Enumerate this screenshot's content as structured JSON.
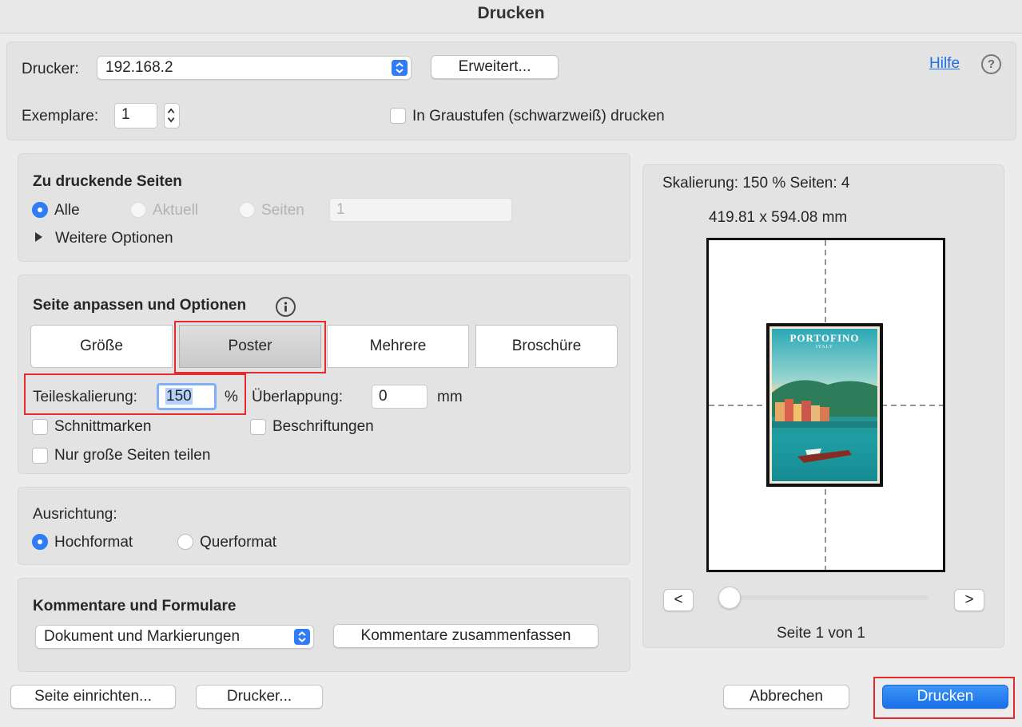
{
  "window": {
    "title": "Drucken"
  },
  "printer": {
    "label": "Drucker:",
    "selected": "192.168.2",
    "advanced_label": "Erweitert...",
    "help_label": "Hilfe",
    "help_icon": "?"
  },
  "copies": {
    "label": "Exemplare:",
    "value": "1",
    "grayscale_label": "In Graustufen (schwarzweiß) drucken",
    "grayscale_checked": false
  },
  "pages": {
    "title": "Zu druckende Seiten",
    "all_label": "Alle",
    "current_label": "Aktuell",
    "pages_label": "Seiten",
    "pages_value": "1",
    "selected": "Alle",
    "more_options": "Weitere Optionen"
  },
  "fit": {
    "title": "Seite anpassen und Optionen",
    "tabs": [
      "Größe",
      "Poster",
      "Mehrere",
      "Broschüre"
    ],
    "active_tab": "Poster",
    "tile_scale_label": "Teileskalierung:",
    "tile_scale_value": "150",
    "tile_scale_unit": "%",
    "overlap_label": "Überlappung:",
    "overlap_value": "0",
    "overlap_unit": "mm",
    "cut_marks": "Schnittmarken",
    "labels": "Beschriftungen",
    "large_pages_only": "Nur große Seiten teilen"
  },
  "orientation": {
    "label": "Ausrichtung:",
    "portrait": "Hochformat",
    "landscape": "Querformat",
    "selected": "Hochformat"
  },
  "comments": {
    "title": "Kommentare und Formulare",
    "selected": "Dokument und Markierungen",
    "summarize_label": "Kommentare zusammenfassen"
  },
  "preview": {
    "scale_text": "Skalierung: 150 % Seiten: 4",
    "dimensions": "419.81 x 594.08 mm",
    "poster_title": "PORTOFINO",
    "poster_subtitle": "ITALY",
    "prev_label": "<",
    "next_label": ">",
    "page_indicator": "Seite 1 von 1"
  },
  "footer": {
    "page_setup": "Seite einrichten...",
    "printer": "Drucker...",
    "cancel": "Abbrechen",
    "print": "Drucken"
  },
  "colors": {
    "accent": "#2f7cf6",
    "highlight_box": "#e52b2b",
    "primary_button": "#1a6fe8"
  }
}
